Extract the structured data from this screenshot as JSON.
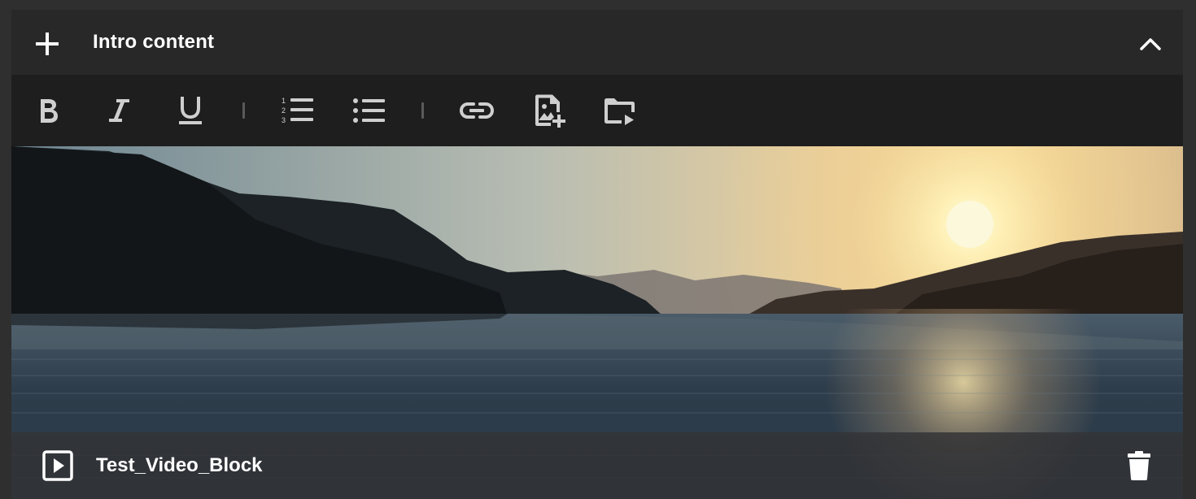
{
  "header": {
    "title": "Intro content",
    "add_icon": "plus-icon",
    "collapse_icon": "chevron-up-icon"
  },
  "toolbar": {
    "buttons": [
      {
        "name": "bold-button",
        "icon": "bold-icon"
      },
      {
        "name": "italic-button",
        "icon": "italic-icon"
      },
      {
        "name": "underline-button",
        "icon": "underline-icon"
      },
      {
        "name": "ordered-list-button",
        "icon": "ordered-list-icon"
      },
      {
        "name": "bullet-list-button",
        "icon": "bullet-list-icon"
      },
      {
        "name": "link-button",
        "icon": "link-icon"
      },
      {
        "name": "add-image-button",
        "icon": "image-add-icon"
      },
      {
        "name": "add-video-button",
        "icon": "folder-play-icon"
      }
    ]
  },
  "media_block": {
    "title": "Test_Video_Block",
    "type_icon": "video-play-icon",
    "delete_icon": "trash-icon"
  },
  "colors": {
    "panel_bg": "#262626",
    "toolbar_bg": "#1e1e1e",
    "icon": "#cfcfcf",
    "text": "#ffffff"
  }
}
